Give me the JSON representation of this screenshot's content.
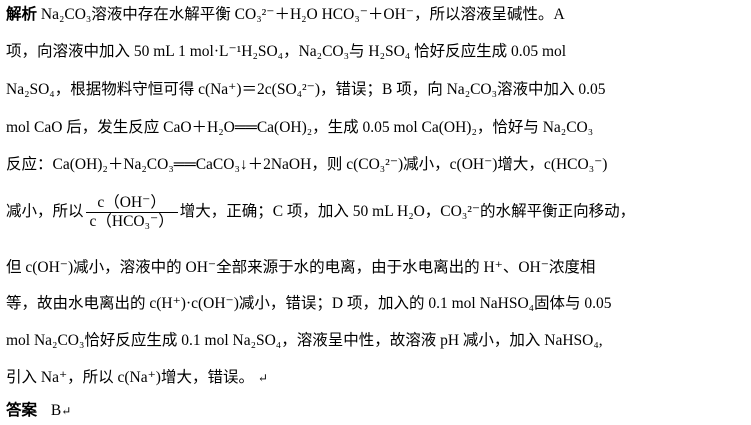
{
  "analysis": {
    "heading": "解析",
    "lines": [
      "Na₂CO₃溶液中存在水解平衡 CO₃²⁻＋H₂O        HCO₃⁻＋OH⁻，所以溶液呈碱性。A",
      "项，向溶液中加入 50 mL 1 mol·L⁻¹H₂SO₄，Na₂CO₃与 H₂SO₄ 恰好反应生成 0.05 mol",
      "Na₂SO₄，根据物料守恒可得 c(Na⁺)＝2c(SO₄²⁻)，错误；B 项，向 Na₂CO₃溶液中加入 0.05",
      "mol CaO 后，发生反应 CaO＋H₂O══Ca(OH)₂，生成 0.05 mol Ca(OH)₂，恰好与 Na₂CO₃",
      "反应：Ca(OH)₂＋Na₂CO₃══CaCO₃↓＋2NaOH，则 c(CO₃²⁻)减小，c(OH⁻)增大，c(HCO₃⁻)"
    ],
    "line6_before": "减小，所以",
    "fraction": {
      "numerator": "c（OH⁻）",
      "denominator": "c（HCO₃⁻）"
    },
    "line6_after": "增大，正确；C 项，加入 50 mL H₂O，CO₃²⁻的水解平衡正向移动，",
    "lines_after": [
      "但 c(OH⁻)减小，溶液中的 OH⁻全部来源于水的电离，由于水电离出的 H⁺、OH⁻浓度相",
      "等，故由水电离出的 c(H⁺)·c(OH⁻)减小，错误；D 项，加入的 0.1 mol NaHSO₄固体与 0.05",
      "mol Na₂CO₃恰好反应生成 0.1 mol Na₂SO₄，溶液呈中性，故溶液 pH 减小，加入 NaHSO₄,",
      "引入 Na⁺，所以 c(Na⁺)增大，错误。"
    ],
    "return_mark": "↵"
  },
  "answer": {
    "heading": "答案",
    "value": "B",
    "return_mark": "↵"
  }
}
